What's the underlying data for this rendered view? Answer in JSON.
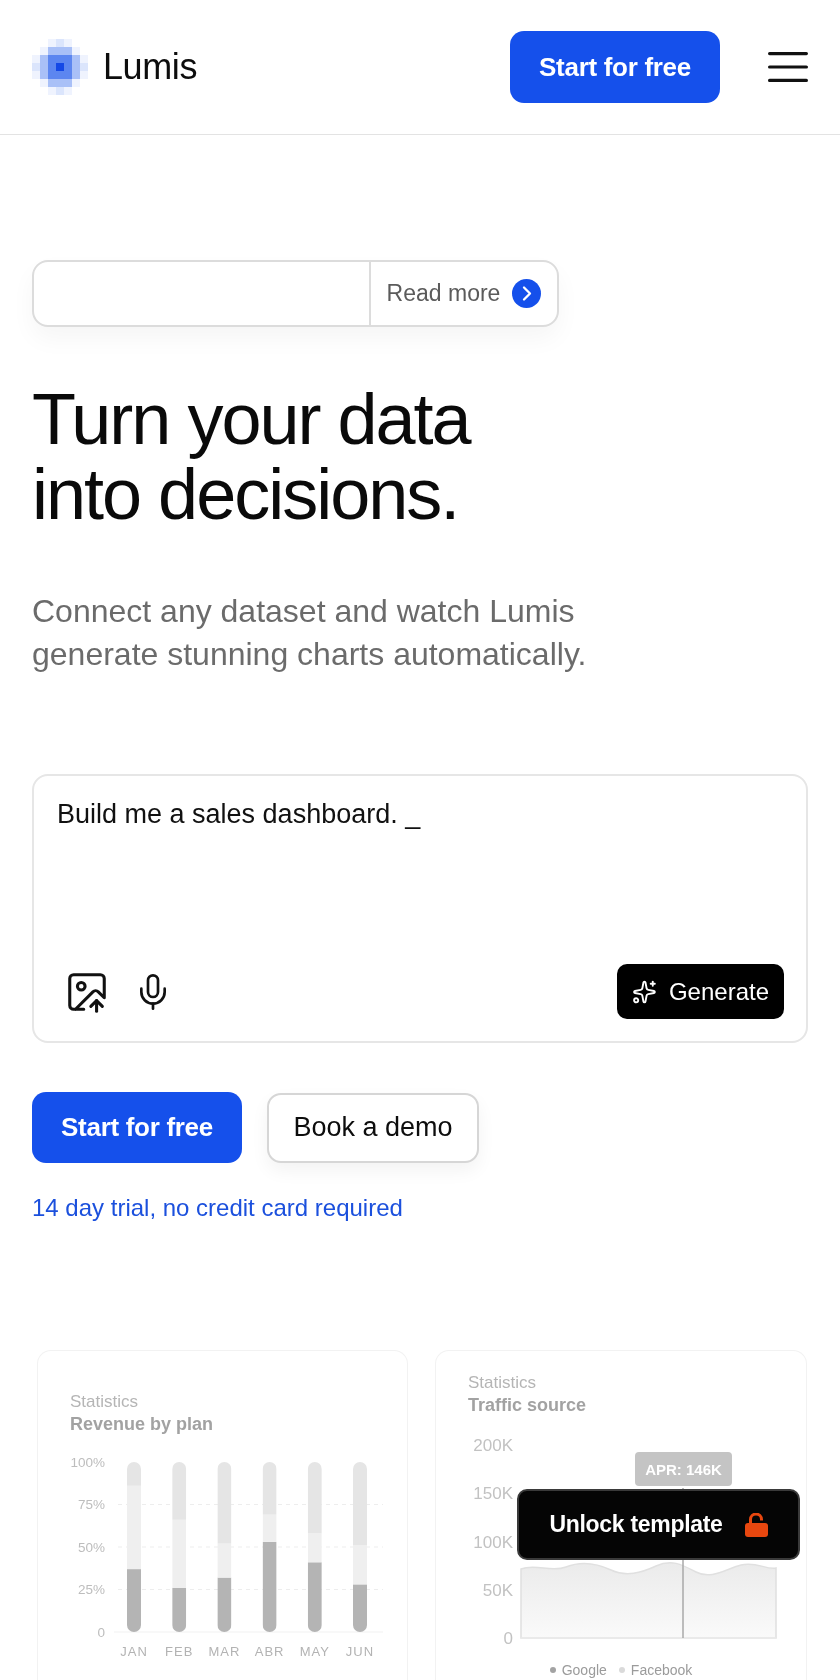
{
  "header": {
    "brand": "Lumis",
    "cta": "Start for free"
  },
  "announcement": {
    "link": "Read more"
  },
  "hero": {
    "title": "Turn your data into decisions.",
    "subtitle": "Connect any dataset and watch Lumis generate stunning charts automatically."
  },
  "prompt": {
    "value": "Build me a sales dashboard. _",
    "action": "Generate"
  },
  "actions": [
    {
      "kind": "primary",
      "label": "Start for free"
    },
    {
      "kind": "secondary",
      "label": "Book a demo"
    }
  ],
  "note": "14 day trial, no credit card required",
  "revenue_card": {
    "eyebrow": "Statistics",
    "chart_data": {
      "type": "bar",
      "title": "Revenue by plan",
      "stacked": true,
      "grid": true,
      "categories": [
        "JAN",
        "FEB",
        "MAR",
        "ABR",
        "MAY",
        "JUN"
      ],
      "ylim": [
        0,
        100
      ],
      "yticks": [
        {
          "value": 0,
          "label": "0"
        },
        {
          "value": 25,
          "label": "25%"
        },
        {
          "value": 50,
          "label": "50%"
        },
        {
          "value": 75,
          "label": "75%"
        },
        {
          "value": 100,
          "label": "100%"
        }
      ],
      "series": [
        {
          "color": "#b4b4b4",
          "values": [
            37,
            26,
            32,
            53,
            41,
            28
          ]
        },
        {
          "color": "#efefef",
          "values": [
            49,
            40,
            20,
            16,
            17,
            23
          ]
        },
        {
          "color": "#e5e5e5",
          "values": [
            14,
            34,
            48,
            31,
            42,
            49
          ]
        }
      ]
    }
  },
  "traffic_card": {
    "eyebrow": "Statistics",
    "title": "Traffic source",
    "y_ticks": [
      "200K",
      "150K",
      "100K",
      "50K",
      "0"
    ],
    "tooltip": "APR: 146K",
    "legend": [
      {
        "label": "Google",
        "color": "#a3a3a3"
      },
      {
        "label": "Facebook",
        "color": "#dadada"
      }
    ]
  },
  "unlock": {
    "label": "Unlock template"
  }
}
